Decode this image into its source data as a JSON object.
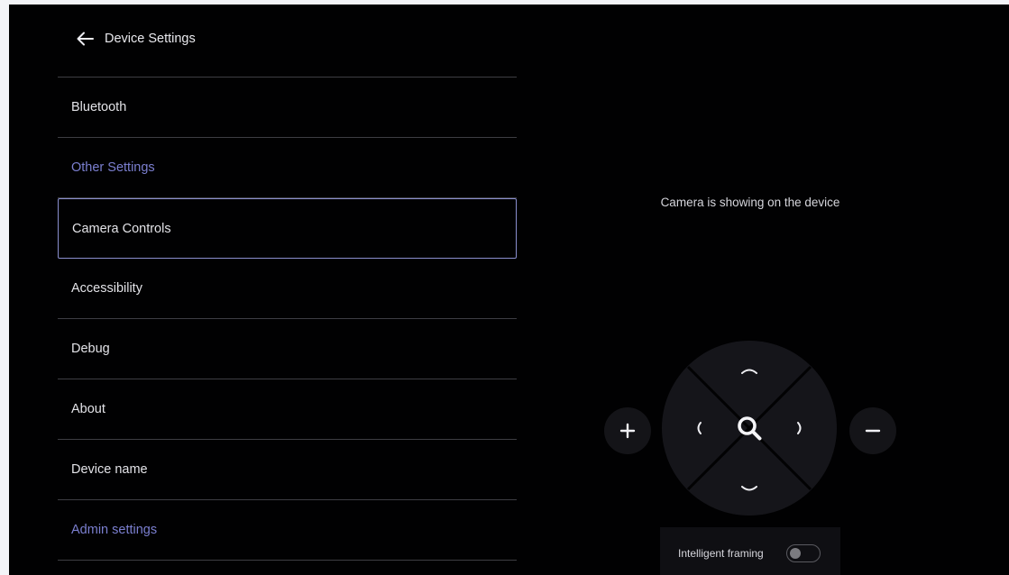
{
  "header": {
    "title": "Device Settings",
    "back_icon": "arrow-left-icon"
  },
  "menu": {
    "items": [
      {
        "label": "Bluetooth",
        "type": "item"
      },
      {
        "label": "Other Settings",
        "type": "section"
      },
      {
        "label": "Camera Controls",
        "type": "item",
        "selected": true
      },
      {
        "label": "Accessibility",
        "type": "item"
      },
      {
        "label": "Debug",
        "type": "item"
      },
      {
        "label": "About",
        "type": "item"
      },
      {
        "label": "Device name",
        "type": "item"
      },
      {
        "label": "Admin settings",
        "type": "section"
      }
    ]
  },
  "camera": {
    "status_text": "Camera is showing on the device",
    "controls": {
      "zoom_in_icon": "plus-icon",
      "zoom_out_icon": "minus-icon",
      "up_icon": "chevron-up-icon",
      "down_icon": "chevron-down-icon",
      "left_icon": "chevron-left-icon",
      "right_icon": "chevron-right-icon",
      "center_icon": "search-icon"
    },
    "intelligent_framing": {
      "label": "Intelligent framing",
      "enabled": false
    }
  },
  "colors": {
    "background": "#010102",
    "text": "#e3e3e8",
    "section_text": "#7b7fd0",
    "selected_border": "#8a8fcf",
    "divider": "#3d3d43"
  }
}
